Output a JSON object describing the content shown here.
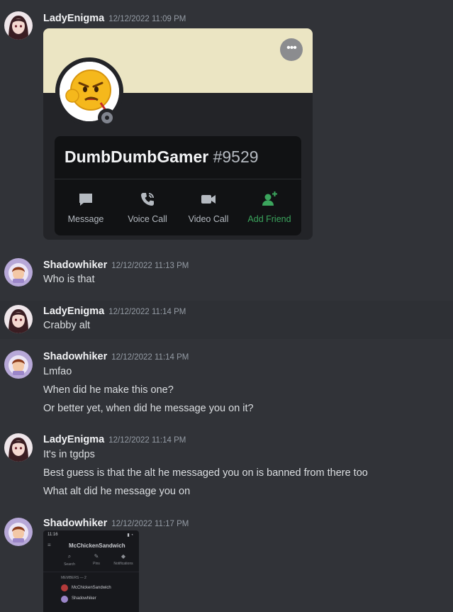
{
  "colors": {
    "background": "#313338",
    "banner": "#ebe5c3",
    "friend_green": "#3ba55d"
  },
  "messages": [
    {
      "user": "LadyEnigma",
      "time": "12/12/2022 11:09 PM"
    },
    {
      "user": "Shadowhiker",
      "time": "12/12/2022 11:13 PM",
      "lines": [
        "Who is that"
      ]
    },
    {
      "user": "LadyEnigma",
      "time": "12/12/2022 11:14 PM",
      "lines": [
        "Crabby alt"
      ]
    },
    {
      "user": "Shadowhiker",
      "time": "12/12/2022 11:14 PM",
      "lines": [
        "Lmfao",
        "When did he make this one?",
        "Or better yet, when did he message you on it?"
      ]
    },
    {
      "user": "LadyEnigma",
      "time": "12/12/2022 11:14 PM",
      "lines": [
        "It's in tgdps",
        "Best guess is that the alt he messaged you on is banned from there too",
        "What alt did he message you on"
      ]
    },
    {
      "user": "Shadowhiker",
      "time": "12/12/2022 11:17 PM"
    }
  ],
  "profile_card": {
    "username": "DumbDumbGamer",
    "discriminator": "#9529",
    "more_icon": "more-options-icon",
    "actions": [
      {
        "label": "Message",
        "icon": "message-icon"
      },
      {
        "label": "Voice Call",
        "icon": "voice-call-icon"
      },
      {
        "label": "Video Call",
        "icon": "video-call-icon"
      },
      {
        "label": "Add Friend",
        "icon": "add-friend-icon"
      }
    ]
  },
  "attachment": {
    "status_time": "11:16",
    "channel": "McChickenSandwich",
    "tools": [
      "Search",
      "Pins",
      "Notifications"
    ],
    "members_header": "MEMBERS — 2",
    "members": [
      "McChickenSandwich",
      "Shadowhiker"
    ]
  }
}
